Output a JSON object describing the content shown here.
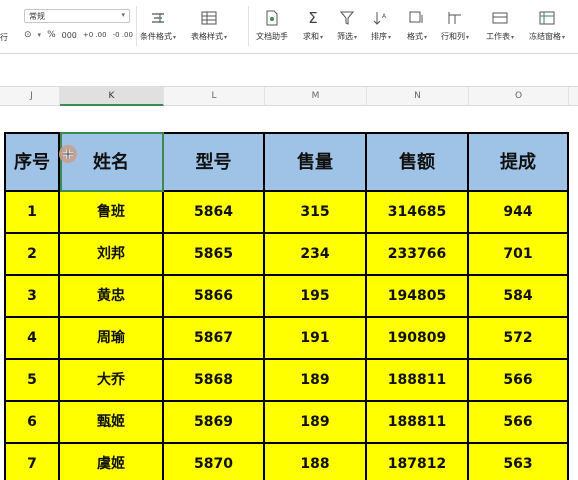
{
  "ribbon": {
    "format_value": "常规",
    "left_edge_label": "行",
    "number_format_icons": [
      "⊙",
      "%",
      "000",
      "+0 .00",
      "-0 .00"
    ],
    "tools": [
      {
        "icon": "conditional-format-icon",
        "label": "条件格式"
      },
      {
        "icon": "table-style-icon",
        "label": "表格样式"
      },
      {
        "icon": "doc-helper-icon",
        "label": "文档助手"
      },
      {
        "icon": "sum-icon",
        "label": "求和"
      },
      {
        "icon": "filter-icon",
        "label": "筛选"
      },
      {
        "icon": "sort-icon",
        "label": "排序"
      },
      {
        "icon": "format-icon",
        "label": "格式"
      },
      {
        "icon": "row-col-icon",
        "label": "行和列"
      },
      {
        "icon": "worksheet-icon",
        "label": "工作表"
      },
      {
        "icon": "freeze-pane-icon",
        "label": "冻结窗格"
      }
    ]
  },
  "columns": [
    "J",
    "K",
    "L",
    "M",
    "N",
    "O"
  ],
  "selected_column": "K",
  "table": {
    "headers": [
      "序号",
      "姓名",
      "型号",
      "售量",
      "售额",
      "提成"
    ],
    "rows": [
      [
        "1",
        "鲁班",
        "5864",
        "315",
        "314685",
        "944"
      ],
      [
        "2",
        "刘邦",
        "5865",
        "234",
        "233766",
        "701"
      ],
      [
        "3",
        "黄忠",
        "5866",
        "195",
        "194805",
        "584"
      ],
      [
        "4",
        "周瑜",
        "5867",
        "191",
        "190809",
        "572"
      ],
      [
        "5",
        "大乔",
        "5868",
        "189",
        "188811",
        "566"
      ],
      [
        "6",
        "甄姬",
        "5869",
        "189",
        "188811",
        "566"
      ],
      [
        "7",
        "虞姬",
        "5870",
        "188",
        "187812",
        "563"
      ]
    ]
  },
  "colors": {
    "header_fill": "#9fc3e6",
    "body_fill": "#ffff00",
    "selection": "#3d8a50"
  }
}
